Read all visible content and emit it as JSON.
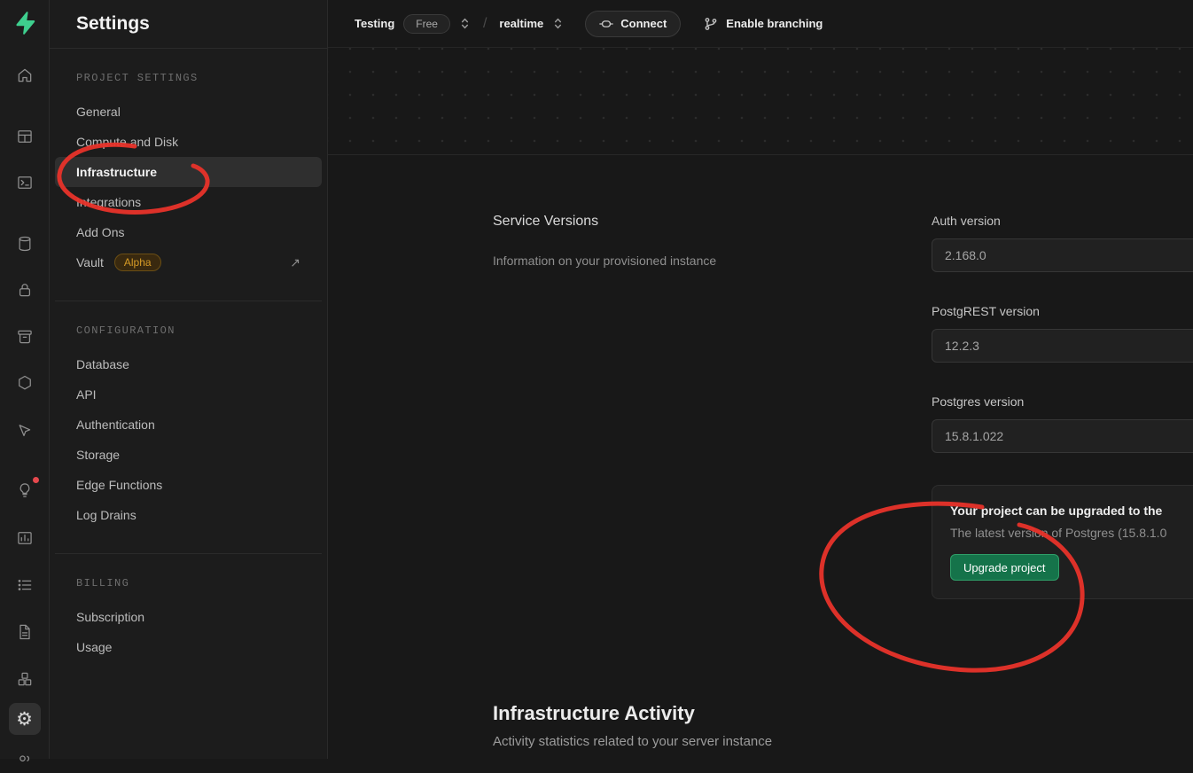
{
  "sidebar": {
    "title": "Settings",
    "sections": [
      {
        "header": "PROJECT SETTINGS",
        "items": [
          {
            "label": "General"
          },
          {
            "label": "Compute and Disk"
          },
          {
            "label": "Infrastructure",
            "selected": true
          },
          {
            "label": "Integrations"
          },
          {
            "label": "Add Ons"
          },
          {
            "label": "Vault",
            "badge": "Alpha",
            "external": true
          }
        ]
      },
      {
        "header": "CONFIGURATION",
        "items": [
          {
            "label": "Database"
          },
          {
            "label": "API"
          },
          {
            "label": "Authentication"
          },
          {
            "label": "Storage"
          },
          {
            "label": "Edge Functions"
          },
          {
            "label": "Log Drains"
          }
        ]
      },
      {
        "header": "BILLING",
        "items": [
          {
            "label": "Subscription"
          },
          {
            "label": "Usage"
          }
        ]
      }
    ]
  },
  "rail": {
    "icons": [
      "supabase-logo",
      "home",
      "table-editor",
      "sql-editor",
      "database",
      "authentication",
      "storage",
      "edge-functions",
      "realtime",
      "advisors",
      "reports",
      "logs",
      "api-docs",
      "integrations",
      "settings"
    ]
  },
  "topbar": {
    "project": "Testing",
    "plan_badge": "Free",
    "separator": "/",
    "branch": "realtime",
    "connect_label": "Connect",
    "branching_label": "Enable branching"
  },
  "content": {
    "service_versions": {
      "title": "Service Versions",
      "description": "Information on your provisioned instance",
      "fields": [
        {
          "label": "Auth version",
          "value": "2.168.0"
        },
        {
          "label": "PostgREST version",
          "value": "12.2.3"
        },
        {
          "label": "Postgres version",
          "value": "15.8.1.022"
        }
      ],
      "upgrade_notice": {
        "title": "Your project can be upgraded to the",
        "description": "The latest version of Postgres (15.8.1.0",
        "button_label": "Upgrade project"
      }
    },
    "activity": {
      "title": "Infrastructure Activity",
      "description": "Activity statistics related to your server instance"
    }
  },
  "colors": {
    "brand_green": "#3ecf8e",
    "upgrade_button_green": "#15734a",
    "annotation_red": "#e8332a",
    "alpha_badge_text": "#d69b26"
  }
}
